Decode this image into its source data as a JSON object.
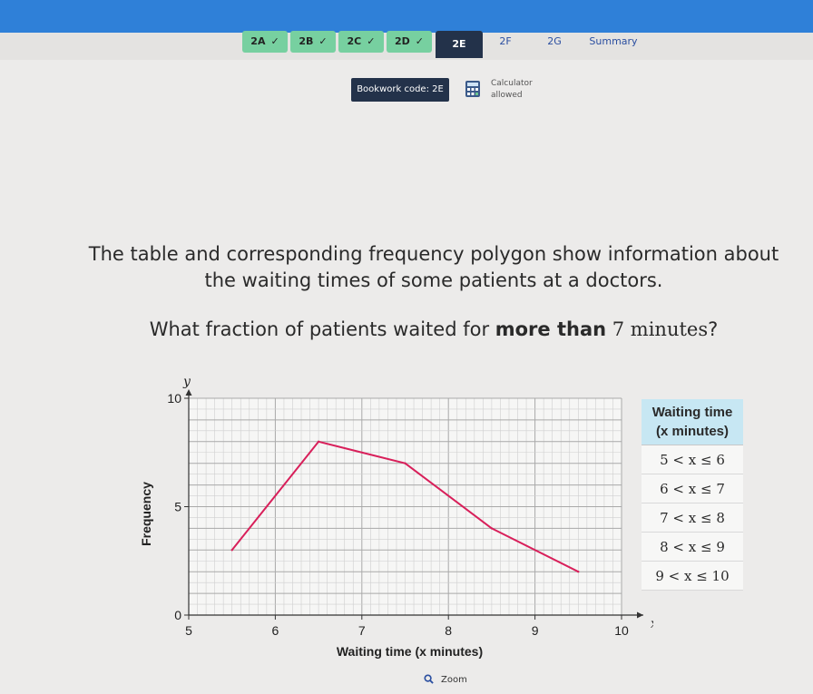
{
  "tabs": [
    {
      "label": "2A",
      "status": "done"
    },
    {
      "label": "2B",
      "status": "done"
    },
    {
      "label": "2C",
      "status": "done"
    },
    {
      "label": "2D",
      "status": "done"
    },
    {
      "label": "2E",
      "status": "active"
    },
    {
      "label": "2F",
      "status": "todo"
    },
    {
      "label": "2G",
      "status": "todo"
    },
    {
      "label": "Summary",
      "status": "todo"
    }
  ],
  "tick_icon": "check-icon",
  "bookwork": {
    "label": "Bookwork code: 2E"
  },
  "calculator": {
    "line1": "Calculator",
    "line2": "allowed",
    "icon": "calculator-icon"
  },
  "question": {
    "line1": "The table and corresponding frequency polygon show information about",
    "line2": "the waiting times of some patients at a doctors.",
    "line3_prefix": "What fraction of patients waited for ",
    "line3_bold": "more than",
    "line3_math": " 7 minutes",
    "line3_suffix": "?"
  },
  "table": {
    "header_line1": "Waiting time",
    "header_line2": "(x minutes)",
    "rows": [
      "5 < x ≤ 6",
      "6 < x ≤ 7",
      "7 < x ≤ 8",
      "8 < x ≤ 9",
      "9 < x ≤ 10"
    ]
  },
  "zoom": {
    "label": "Zoom",
    "icon": "magnifier-icon"
  },
  "colors": {
    "topbar": "#2f80d8",
    "tab_done": "#77d0a0",
    "tab_active": "#23324a",
    "polygon": "#d81f5a",
    "table_header": "#c7e7f3"
  },
  "chart_data": {
    "type": "line",
    "xlabel": "Waiting time (x minutes)",
    "ylabel": "Frequency",
    "x_axis_symbol": "x",
    "y_axis_symbol": "y",
    "xlim": [
      5,
      10
    ],
    "ylim": [
      0,
      10
    ],
    "xticks": [
      5,
      6,
      7,
      8,
      9,
      10
    ],
    "yticks": [
      0,
      5,
      10
    ],
    "grid": true,
    "series": [
      {
        "x": [
          5.5,
          6.5,
          7.5,
          8.5,
          9.5
        ],
        "y": [
          3,
          8,
          7,
          4,
          2
        ]
      }
    ]
  }
}
